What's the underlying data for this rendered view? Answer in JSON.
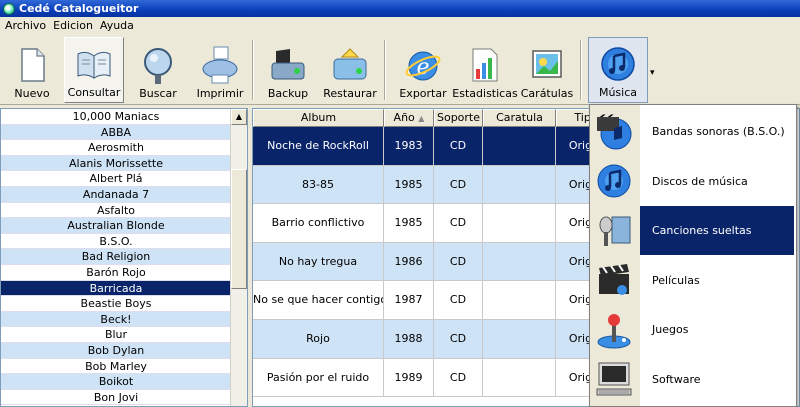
{
  "window": {
    "title": "Cedé Catalogueitor"
  },
  "menu": [
    "Archivo",
    "Edicion",
    "Ayuda"
  ],
  "toolbar": {
    "buttons": [
      {
        "label": "Nuevo",
        "icon": "new-document-icon"
      },
      {
        "label": "Consultar",
        "icon": "open-book-icon"
      },
      {
        "label": "Buscar",
        "icon": "magnifier-icon"
      },
      {
        "label": "Imprimir",
        "icon": "printer-icon"
      },
      {
        "label": "Backup",
        "icon": "backup-drive-icon"
      },
      {
        "label": "Restaurar",
        "icon": "restore-drive-icon"
      },
      {
        "label": "Exportar",
        "icon": "internet-explorer-icon"
      },
      {
        "label": "Estadisticas",
        "icon": "statistics-chart-icon"
      },
      {
        "label": "Carátulas",
        "icon": "cover-art-icon"
      },
      {
        "label": "Música",
        "icon": "music-disc-icon"
      }
    ]
  },
  "artists": {
    "items": [
      "10,000 Maniacs",
      "ABBA",
      "Aerosmith",
      "Alanis Morissette",
      "Albert Plá",
      "Andanada 7",
      "Asfalto",
      "Australian Blonde",
      "B.S.O.",
      "Bad Religion",
      "Barón Rojo",
      "Barricada",
      "Beastie Boys",
      "Beck!",
      "Blur",
      "Bob Dylan",
      "Bob Marley",
      "Boikot",
      "Bon Jovi"
    ],
    "selected": "Barricada"
  },
  "albums": {
    "columns": [
      "Album",
      "Año",
      "Soporte",
      "Caratula",
      "Tipo"
    ],
    "rows": [
      {
        "album": "Noche de RockRoll",
        "year": "1983",
        "support": "CD",
        "cover": "",
        "type": "Origin"
      },
      {
        "album": "83-85",
        "year": "1985",
        "support": "CD",
        "cover": "",
        "type": "Origin"
      },
      {
        "album": "Barrio conflictivo",
        "year": "1985",
        "support": "CD",
        "cover": "",
        "type": "Origin"
      },
      {
        "album": "No hay tregua",
        "year": "1986",
        "support": "CD",
        "cover": "",
        "type": "Origin"
      },
      {
        "album": "No se que hacer contigo",
        "year": "1987",
        "support": "CD",
        "cover": "",
        "type": "Origin"
      },
      {
        "album": "Rojo",
        "year": "1988",
        "support": "CD",
        "cover": "",
        "type": "Origin"
      },
      {
        "album": "Pasión por el ruido",
        "year": "1989",
        "support": "CD",
        "cover": "",
        "type": "Origin"
      }
    ],
    "selected_row": 0
  },
  "music_menu": {
    "items": [
      {
        "label": "Bandas sonoras (B.S.O.)",
        "icon": "soundtrack-music-icon"
      },
      {
        "label": "Discos de música",
        "icon": "music-disc-icon"
      },
      {
        "label": "Canciones sueltas",
        "icon": "microphone-icon"
      },
      {
        "label": "Películas",
        "icon": "film-clapper-icon"
      },
      {
        "label": "Juegos",
        "icon": "joystick-icon"
      },
      {
        "label": "Software",
        "icon": "computer-icon"
      }
    ],
    "highlighted": 2
  },
  "colors": {
    "selection": "#0a246a",
    "alt_row": "#cfe3f6",
    "titlebar": "#0a3fb8"
  }
}
